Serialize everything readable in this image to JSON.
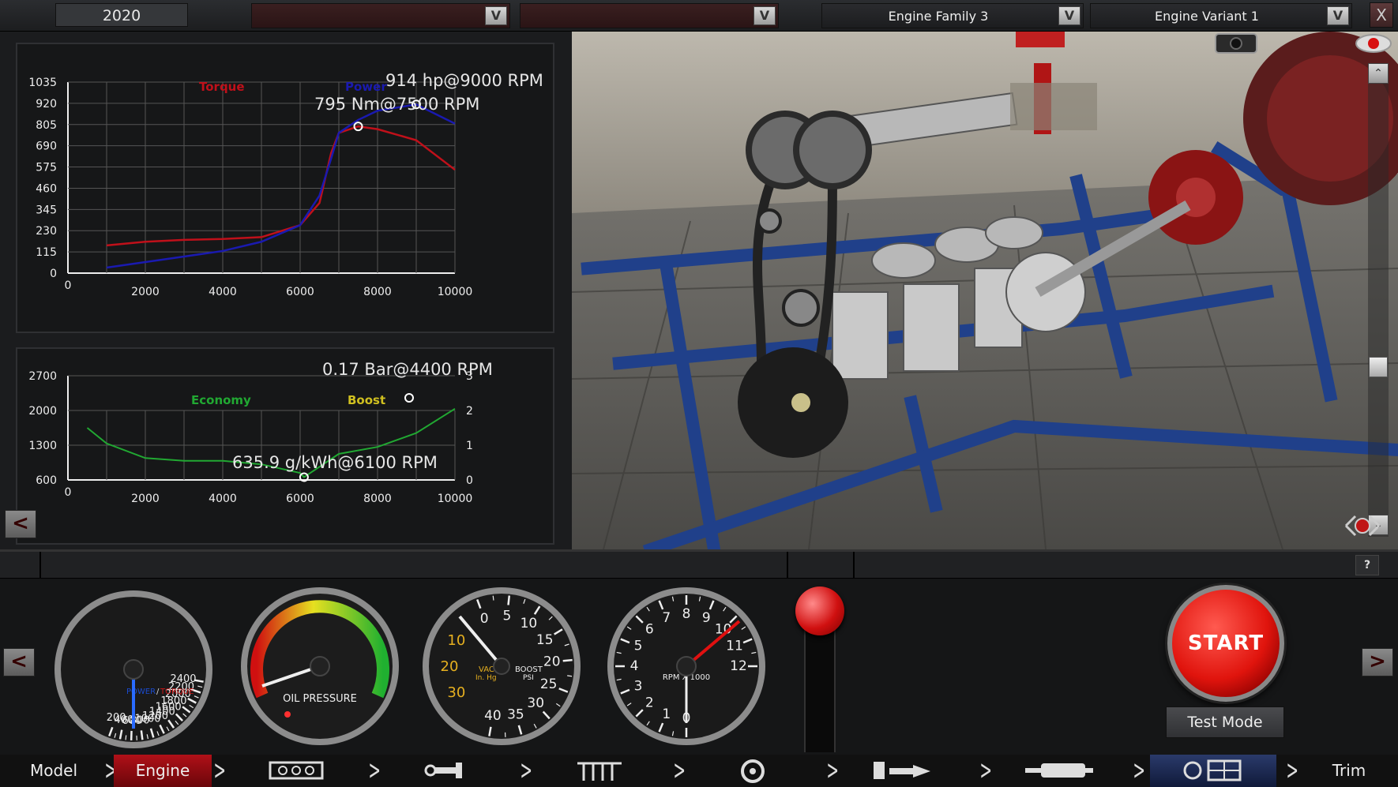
{
  "topbar": {
    "year": "2020",
    "combo1": "",
    "combo2": "",
    "family": "Engine Family 3",
    "variant": "Engine Variant 1",
    "dropdown_arrow": "V",
    "close": "X"
  },
  "chart_data": [
    {
      "type": "line",
      "title": "",
      "series": [
        {
          "name": "Torque",
          "color": "#c0101a",
          "x": [
            1000,
            2000,
            3000,
            4000,
            5000,
            6000,
            6500,
            6800,
            7000,
            7500,
            8000,
            9000,
            10000
          ],
          "y": [
            150,
            170,
            180,
            185,
            195,
            260,
            380,
            650,
            760,
            795,
            780,
            720,
            560
          ]
        },
        {
          "name": "Power",
          "color": "#1a1ab0",
          "x": [
            1000,
            2000,
            3000,
            4000,
            5000,
            6000,
            6500,
            6800,
            7000,
            7500,
            8000,
            9000,
            10000
          ],
          "y": [
            30,
            60,
            90,
            120,
            170,
            260,
            420,
            620,
            760,
            830,
            880,
            914,
            810
          ]
        }
      ],
      "x_ticks": [
        "0",
        "2000",
        "4000",
        "6000",
        "8000",
        "10000"
      ],
      "y_ticks": [
        "0",
        "115",
        "230",
        "345",
        "460",
        "575",
        "690",
        "805",
        "920",
        "1035"
      ],
      "xlim": [
        0,
        10000
      ],
      "ylim": [
        0,
        1035
      ],
      "annotations": [
        "914 hp@9000 RPM",
        "795 Nm@7500 RPM"
      ],
      "markers": [
        {
          "x": 9000,
          "y": 914
        },
        {
          "x": 7500,
          "y": 795
        }
      ]
    },
    {
      "type": "line",
      "title": "",
      "series": [
        {
          "name": "Economy",
          "color": "#21a832",
          "x": [
            500,
            1000,
            2000,
            3000,
            4000,
            5000,
            6000,
            6100,
            7000,
            8000,
            9000,
            10000
          ],
          "y": [
            1.5,
            1.05,
            0.63,
            0.55,
            0.55,
            0.45,
            0.2,
            0.08,
            0.75,
            0.95,
            1.35,
            2.05
          ]
        },
        {
          "name": "Boost",
          "color": "#d0c020",
          "x": [],
          "y": []
        }
      ],
      "x_ticks": [
        "0",
        "2000",
        "4000",
        "6000",
        "8000",
        "10000"
      ],
      "y_ticks_left": [
        "600",
        "1300",
        "2000",
        "2700"
      ],
      "y_ticks_right": [
        "0",
        "1",
        "2",
        "3"
      ],
      "xlim": [
        0,
        10000
      ],
      "ylim_right": [
        0,
        3
      ],
      "annotations": [
        "0.17 Bar@4400 RPM",
        "635.9 g/kWh@6100 RPM"
      ]
    }
  ],
  "chart1_labels": {
    "torque": "Torque",
    "power": "Power",
    "ann_power": "914 hp@9000 RPM",
    "ann_torque": "795 Nm@7500 RPM"
  },
  "chart2_labels": {
    "economy": "Economy",
    "boost": "Boost",
    "ann_boost": "0.17 Bar@4400 RPM",
    "ann_econ": "635.9 g/kWh@6100 RPM"
  },
  "nav": {
    "back": "<",
    "forward": ">"
  },
  "gauges": {
    "power_torque": {
      "labels": [
        "200",
        "400",
        "600",
        "800",
        "1000",
        "1200",
        "1400",
        "1600",
        "1800",
        "2000",
        "2200",
        "2400"
      ],
      "caption_power": "POWER",
      "caption_sep": "/",
      "caption_torque": "TORQUE"
    },
    "oil": {
      "caption": "OIL PRESSURE"
    },
    "boost": {
      "vac_labels": [
        "10",
        "20",
        "30"
      ],
      "boost_labels": [
        "0",
        "5",
        "10",
        "15",
        "20",
        "25",
        "30",
        "35",
        "40"
      ],
      "vac_caption": "VAC",
      "vac_unit": "In. Hg",
      "boost_caption": "BOOST",
      "boost_unit": "PSI"
    },
    "rpm": {
      "labels": [
        "0",
        "1",
        "2",
        "3",
        "4",
        "5",
        "6",
        "7",
        "8",
        "9",
        "10",
        "11",
        "12"
      ],
      "caption": "RPM X 1000"
    }
  },
  "dash": {
    "help": "?",
    "start": "START",
    "test_mode": "Test Mode"
  },
  "bottomnav": {
    "model": "Model",
    "engine": "Engine",
    "trim": "Trim"
  },
  "colors": {
    "accent_red": "#c0101a",
    "power_blue": "#1a1ab0",
    "economy_green": "#21a832",
    "boost_yellow": "#d0c020"
  }
}
